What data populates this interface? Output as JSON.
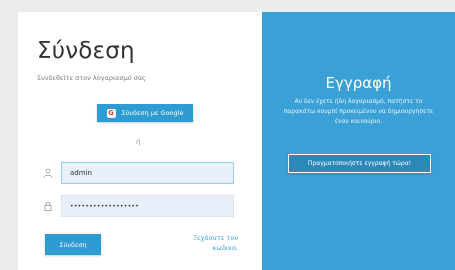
{
  "login": {
    "title": "Σύνδεση",
    "subtitle": "Συνδεθείτε στον λογαριασμό σας",
    "google_button_label": "Σύνδεση με Google",
    "or_label": "ή",
    "username_value": "admin",
    "password_value": "••••••••••••••••••",
    "submit_label": "Σύνδεση",
    "forgot_password_label": "Ξεχάσατε τον κωδικό;"
  },
  "signup": {
    "title": "Εγγραφή",
    "text": "Αν δεν έχετε ήδη λογαριασμό, πατήστε το παρακάτω κουμπί προκειμένου να δημιουργήσετε έναν καινούριο.",
    "button_label": "Πραγματοποιήστε εγγραφή τώρα!"
  },
  "colors": {
    "accent": "#2f9bd3",
    "signup_panel": "#3aa0d5",
    "input_bg": "#e8f0fb"
  },
  "icons": {
    "google": "google-icon",
    "user": "user-icon",
    "lock": "lock-icon"
  }
}
